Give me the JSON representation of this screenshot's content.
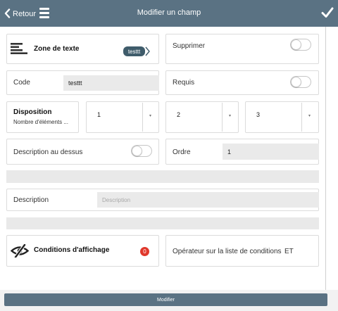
{
  "header": {
    "back_label": "Retour",
    "title": "Modifier un champ",
    "back_icon": "chevron-left-icon",
    "menu_icon": "hamburger-menu-icon",
    "confirm_icon": "checkmark-icon",
    "color": "#5a7283"
  },
  "field_type": {
    "label": "Zone de texte",
    "icon": "text-lines-icon",
    "tag": "testtt",
    "tag_color": "#3f5c6b"
  },
  "delete": {
    "label": "Supprimer",
    "enabled": false
  },
  "code": {
    "label": "Code",
    "value": "testtt"
  },
  "required": {
    "label": "Requis",
    "enabled": false
  },
  "layout": {
    "title": "Disposition",
    "subtitle": "Nombre d'éléments ...",
    "options": [
      {
        "value": "1",
        "arrow": "▾"
      },
      {
        "value": "2",
        "arrow": "▾"
      },
      {
        "value": "3",
        "arrow": "▾"
      }
    ]
  },
  "description_above": {
    "label": "Description au dessus",
    "enabled": false
  },
  "order": {
    "label": "Ordre",
    "value": "1"
  },
  "description": {
    "label": "Description",
    "placeholder": "Description"
  },
  "display_conditions": {
    "label": "Conditions d'affichage",
    "icon": "eye-slash-icon",
    "count": "0",
    "badge_color": "#e0382c"
  },
  "condition_operator": {
    "label": "Opérateur sur la liste de conditions",
    "value": "ET"
  },
  "footer": {
    "submit_label": "Modifier"
  }
}
